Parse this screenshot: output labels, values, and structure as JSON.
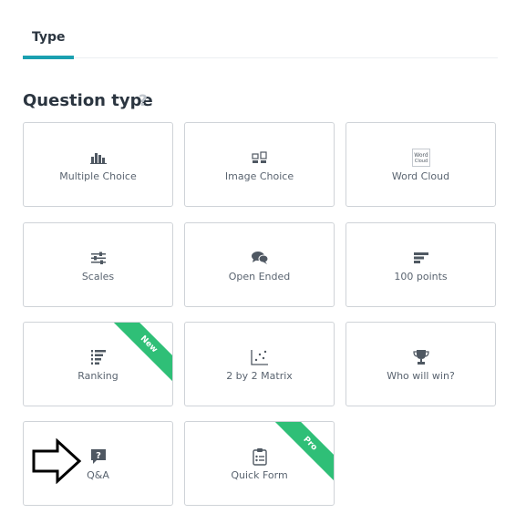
{
  "tabs": {
    "active_label": "Type"
  },
  "section": {
    "title": "Question type",
    "help": "?"
  },
  "cards": [
    {
      "label": "Multiple Choice",
      "icon": "bar-chart-icon"
    },
    {
      "label": "Image Choice",
      "icon": "image-choice-icon"
    },
    {
      "label": "Word Cloud",
      "icon": "word-cloud-icon",
      "icon_text": [
        "Word",
        "Cloud"
      ]
    },
    {
      "label": "Scales",
      "icon": "sliders-icon"
    },
    {
      "label": "Open Ended",
      "icon": "speech-bubbles-icon"
    },
    {
      "label": "100 points",
      "icon": "horizontal-bars-icon"
    },
    {
      "label": "Ranking",
      "icon": "ranking-icon",
      "ribbon": "New"
    },
    {
      "label": "2 by 2 Matrix",
      "icon": "scatter-matrix-icon"
    },
    {
      "label": "Who will win?",
      "icon": "trophy-icon"
    },
    {
      "label": "Q&A",
      "icon": "question-bubble-icon"
    },
    {
      "label": "Quick Form",
      "icon": "clipboard-form-icon",
      "ribbon": "Pro"
    }
  ],
  "colors": {
    "accent": "#1ba0b0",
    "ribbon": "#2fbf77",
    "icon": "#4f5862",
    "border": "#cfd3d8"
  },
  "annotation": {
    "icon": "right-arrow-icon"
  }
}
